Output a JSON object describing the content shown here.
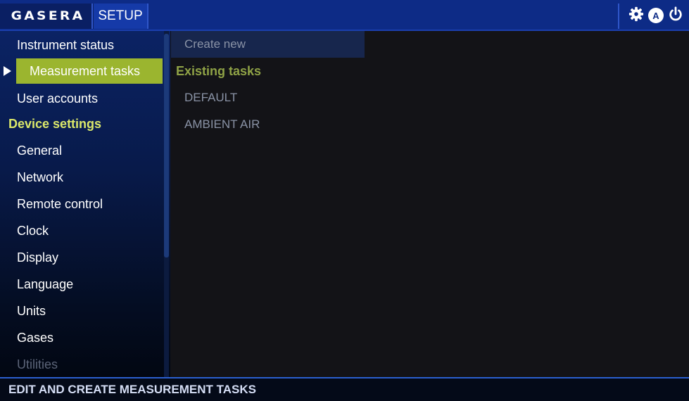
{
  "header": {
    "logo_text": "GASERA",
    "active_tab": "SETUP",
    "icons": [
      "gear-icon",
      "user-a-icon",
      "power-icon"
    ],
    "user_badge": "A"
  },
  "sidebar": {
    "items": [
      {
        "label": "Instrument status",
        "state": "normal"
      },
      {
        "label": "Measurement tasks",
        "state": "selected"
      },
      {
        "label": "User accounts",
        "state": "normal"
      }
    ],
    "section_header": "Device settings",
    "device_items": [
      {
        "label": "General"
      },
      {
        "label": "Network"
      },
      {
        "label": "Remote control"
      },
      {
        "label": "Clock"
      },
      {
        "label": "Display"
      },
      {
        "label": "Language"
      },
      {
        "label": "Units"
      },
      {
        "label": "Gases"
      },
      {
        "label": "Utilities",
        "state": "disabled"
      }
    ]
  },
  "main": {
    "create_new_label": "Create new",
    "existing_header": "Existing tasks",
    "tasks": [
      "DEFAULT",
      "AMBIENT AIR"
    ]
  },
  "status_bar": {
    "text": "EDIT AND CREATE MEASUREMENT TASKS"
  },
  "colors": {
    "topbar": "#0d2b86",
    "selected_item": "#9bb52f",
    "section_header": "#dbe86a",
    "existing_header": "#8fa246",
    "status_border": "#2b5fd0"
  }
}
